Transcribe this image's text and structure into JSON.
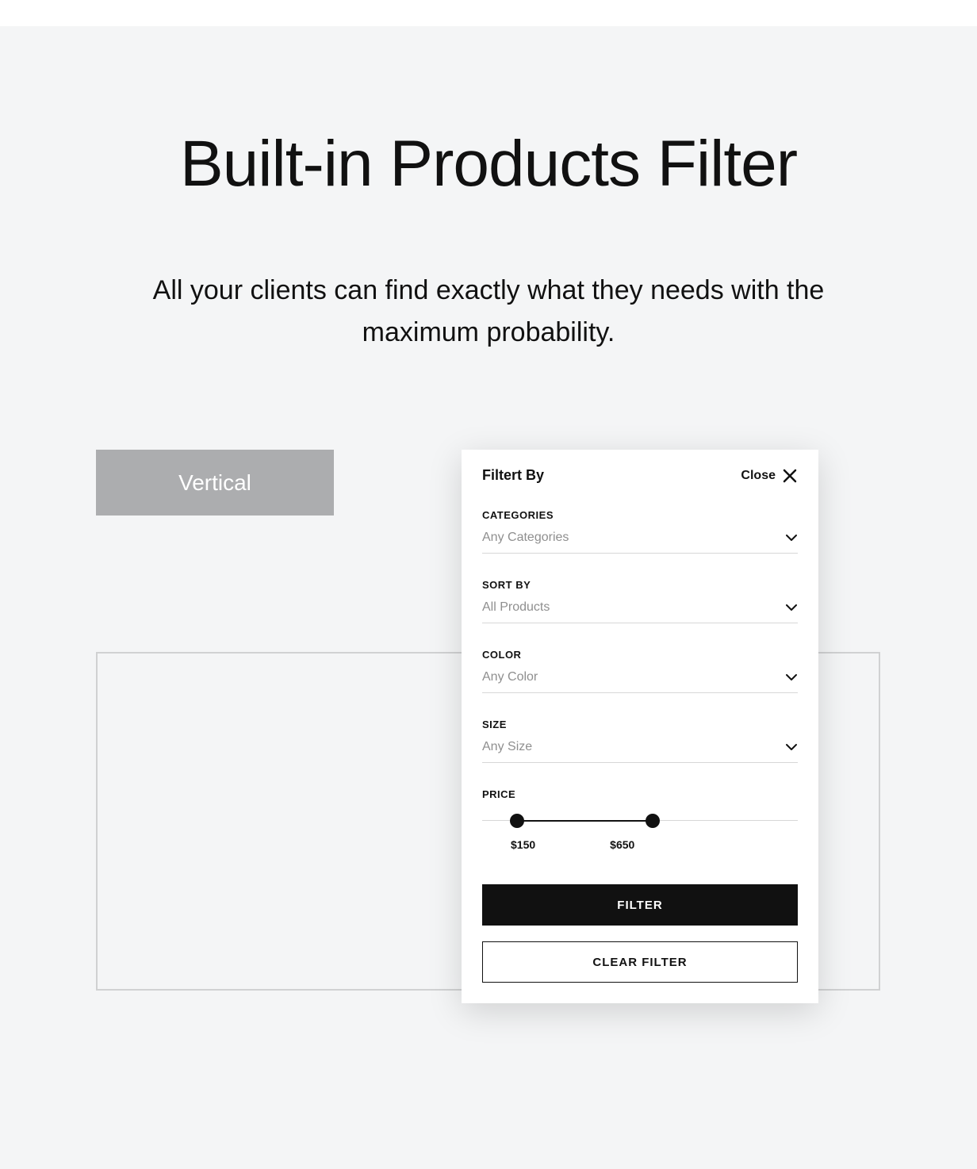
{
  "headline": "Built-in Products Filter",
  "subhead": "All your clients can find exactly what they needs with the maximum probability.",
  "tab": {
    "vertical_label": "Vertical"
  },
  "panel": {
    "title": "Filtert By",
    "close_label": "Close",
    "sections": {
      "categories": {
        "label": "CATEGORIES",
        "value": "Any Categories"
      },
      "sort": {
        "label": "SORT BY",
        "value": "All Products"
      },
      "color": {
        "label": "COLOR",
        "value": "Any Color"
      },
      "size": {
        "label": "SIZE",
        "value": "Any Size"
      },
      "price": {
        "label": "PRICE",
        "min_label": "$150",
        "max_label": "$650"
      }
    },
    "buttons": {
      "filter": "FILTER",
      "clear": "CLEAR FILTER"
    }
  },
  "slider": {
    "min_percent": 11,
    "max_percent": 54
  }
}
